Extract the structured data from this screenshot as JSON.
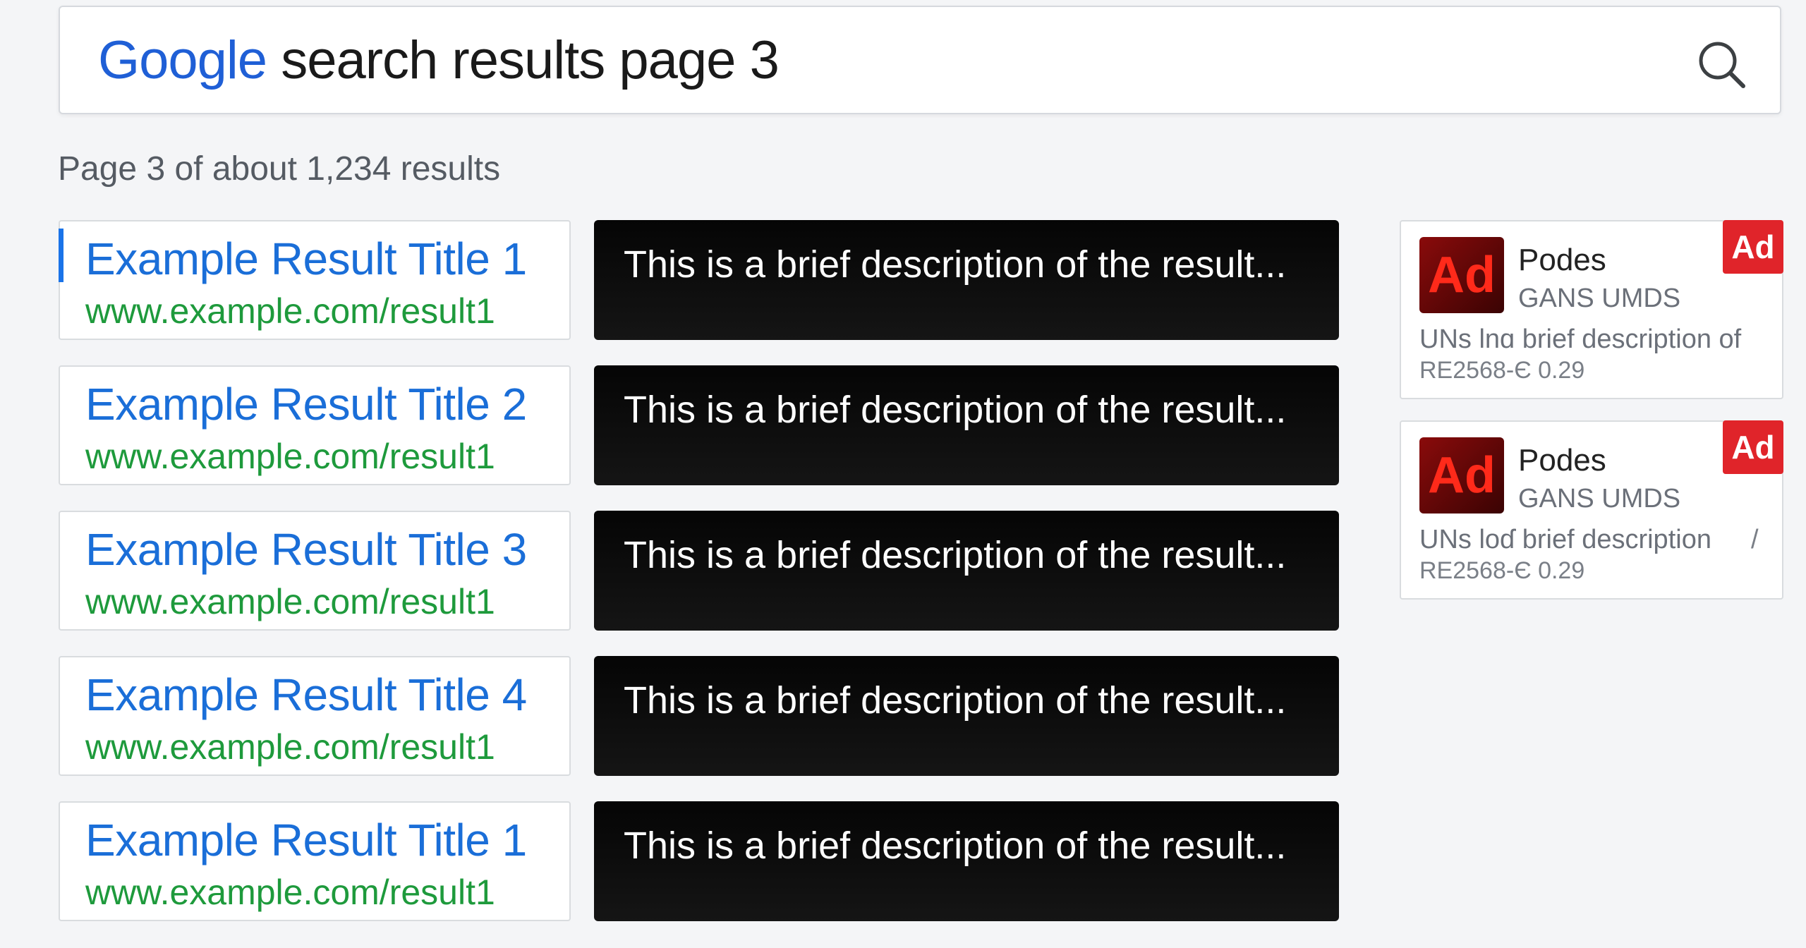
{
  "search": {
    "brand": "Google",
    "query": " search results page 3"
  },
  "results_count": "Page 3 of about 1,234 results",
  "results": [
    {
      "title": "Example Result Title 1",
      "url": "www.example.com/result1",
      "description": "This is a brief description of the result..."
    },
    {
      "title": "Example Result Title 2",
      "url": "www.example.com/result1",
      "description": "This is a brief description of the result..."
    },
    {
      "title": "Example Result Title 3",
      "url": "www.example.com/result1",
      "description": "This is a brief description of the result..."
    },
    {
      "title": "Example Result Title 4",
      "url": "www.example.com/result1",
      "description": "This is a brief description of the result..."
    },
    {
      "title": "Example Result Title 1",
      "url": "www.example.com/result1",
      "description": "This is a brief description of the result..."
    }
  ],
  "ads": [
    {
      "logo": "Ad",
      "badge": "Ad",
      "name": "Podes",
      "subtitle": "GANS UMDS",
      "description": "UNs lnɑ brief description of",
      "code": "RE2568-Є 0.29",
      "mark": ""
    },
    {
      "logo": "Ad",
      "badge": "Ad",
      "name": "Podes",
      "subtitle": "GANS UMDS",
      "description": "UNs loɗ brief description",
      "code": "RE2568-Є 0.29",
      "mark": "/"
    }
  ],
  "colors": {
    "brand_blue": "#1f5fd6",
    "link_blue": "#1a6ed8",
    "url_green": "#1e9a3c",
    "ad_red": "#e0242a"
  },
  "icons": {
    "search": "search-icon"
  }
}
